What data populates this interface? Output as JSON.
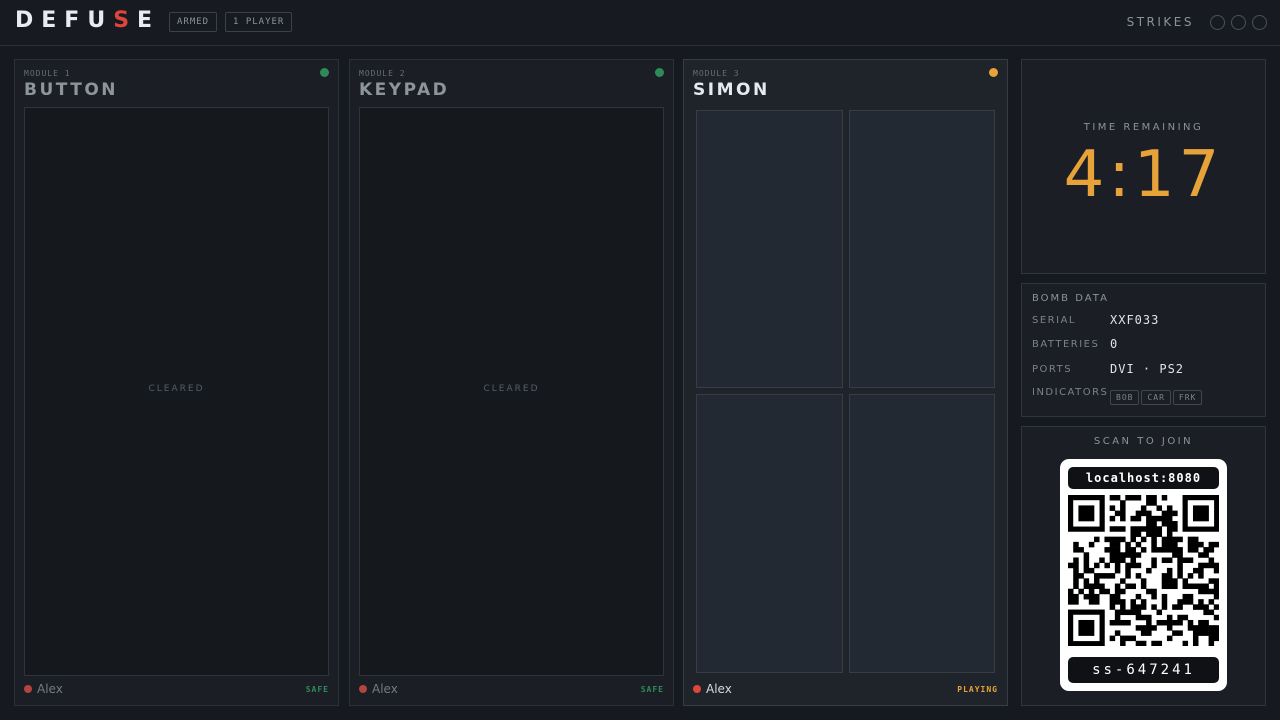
{
  "header": {
    "logo": {
      "before": "DEFU",
      "accent": "S",
      "after": "E"
    },
    "chips": [
      "ARMED",
      "1 PLAYER"
    ],
    "strikes_label": "STRIKES",
    "strikes": {
      "count": 0,
      "max": 3
    }
  },
  "modules": [
    {
      "num": "MODULE 1",
      "title": "BUTTON",
      "led": "green",
      "body_text": "CLEARED",
      "player": "Alex",
      "status": "SAFE"
    },
    {
      "num": "MODULE 2",
      "title": "KEYPAD",
      "led": "green",
      "body_text": "CLEARED",
      "player": "Alex",
      "status": "SAFE"
    },
    {
      "num": "MODULE 3",
      "title": "SIMON",
      "led": "orange",
      "body_text": "",
      "player": "Alex",
      "status": "PLAYING"
    }
  ],
  "timer": {
    "label": "TIME REMAINING",
    "value": "4:17"
  },
  "bomb_data": {
    "title": "BOMB DATA",
    "serial_label": "SERIAL",
    "serial": "XXF033",
    "batteries_label": "BATTERIES",
    "batteries": "0",
    "ports_label": "PORTS",
    "ports": "DVI · PS2",
    "indicators_label": "INDICATORS",
    "indicators": [
      "BOB",
      "CAR",
      "FRK"
    ]
  },
  "join": {
    "label": "SCAN TO JOIN",
    "host": "localhost:8080",
    "code": "ss-647241"
  },
  "colors": {
    "accent_red": "#e0453a",
    "accent_orange": "#e8a23a",
    "safe_green": "#2f8a5a"
  }
}
